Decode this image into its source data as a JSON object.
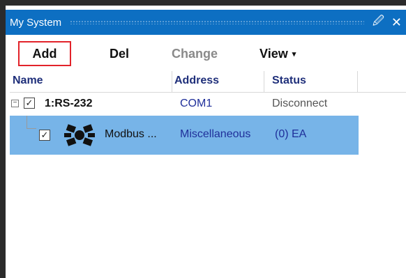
{
  "window": {
    "title": "My System",
    "pin_glyph": "1̂",
    "close_glyph": "✕"
  },
  "toolbar": {
    "add": "Add",
    "del": "Del",
    "change": "Change",
    "view": "View",
    "view_caret": "▾"
  },
  "columns": {
    "name": "Name",
    "address": "Address",
    "status": "Status"
  },
  "tree": {
    "root": {
      "expander": "−",
      "checked": "✓",
      "name": "1:RS-232",
      "address": "COM1",
      "status": "Disconnect"
    },
    "child": {
      "checked": "✓",
      "name": "Modbus ...",
      "address": "Miscellaneous",
      "status": "(0) EA",
      "icon": "modbus-device-icon"
    }
  },
  "colors": {
    "title_bar": "#0d6fc2",
    "selection": "#77b4e8",
    "header_text": "#1f2f7a",
    "address_text": "#1f2f9a",
    "highlight_border": "#e2232a"
  }
}
